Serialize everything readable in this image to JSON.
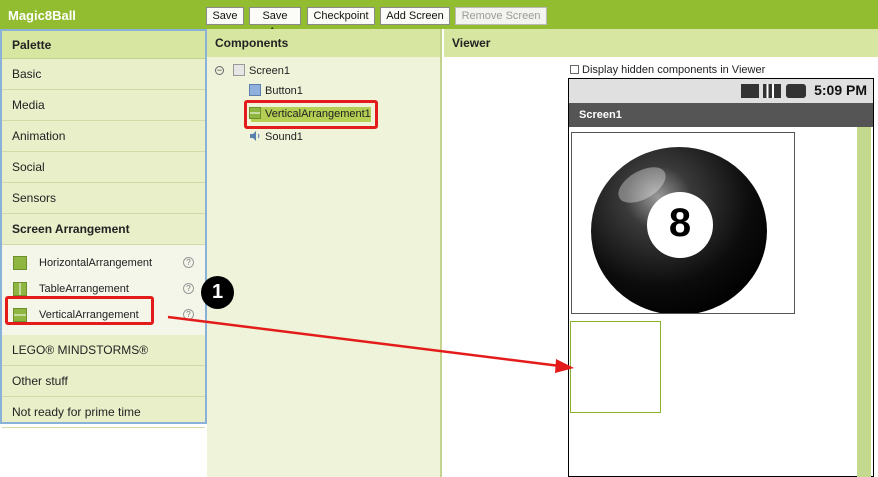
{
  "app": {
    "title": "Magic8Ball"
  },
  "toolbar": {
    "save": "Save",
    "save_as": "Save As",
    "checkpoint": "Checkpoint",
    "add_screen": "Add Screen",
    "remove_screen": "Remove Screen"
  },
  "palette": {
    "header": "Palette",
    "categories": {
      "basic": "Basic",
      "media": "Media",
      "animation": "Animation",
      "social": "Social",
      "sensors": "Sensors",
      "screen_arrangement": "Screen Arrangement",
      "lego": "LEGO® MINDSTORMS®",
      "other": "Other stuff",
      "not_ready": "Not ready for prime time"
    },
    "items": [
      {
        "label": "HorizontalArrangement",
        "icon": "horizontal-arrangement-icon"
      },
      {
        "label": "TableArrangement",
        "icon": "table-arrangement-icon"
      },
      {
        "label": "VerticalArrangement",
        "icon": "vertical-arrangement-icon"
      }
    ],
    "help_glyph": "?"
  },
  "components": {
    "header": "Components",
    "collapse_glyph": "−",
    "tree": {
      "screen": "Screen1",
      "children": [
        "Button1",
        "VerticalArrangement1",
        "Sound1"
      ]
    }
  },
  "viewer": {
    "header": "Viewer",
    "display_hidden_label": "Display hidden components in Viewer",
    "display_hidden_checked": false,
    "phone": {
      "time": "5:09 PM",
      "screen_title": "Screen1",
      "ball_number": "8"
    }
  },
  "annotation": {
    "callout_number": "1",
    "highlight_color": "#e41b1b"
  },
  "colors": {
    "top_bar": "#93bd31",
    "panel_header": "#d7e6a1",
    "palette_border": "#8ab2d8"
  }
}
